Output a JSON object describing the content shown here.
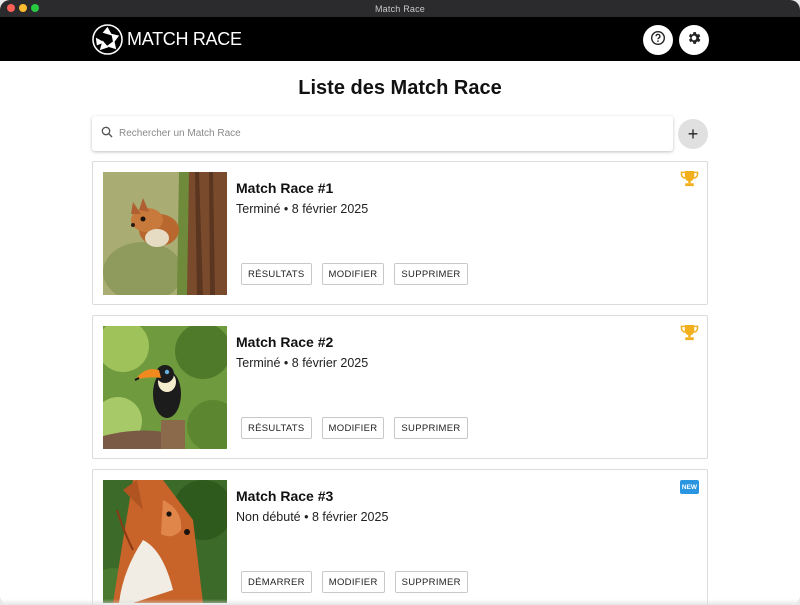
{
  "window": {
    "title": "Match Race"
  },
  "appbar": {
    "brand": "MATCH RACE",
    "logo_icon": "shutter-icon",
    "help_icon": "help-circle-icon",
    "settings_icon": "gear-icon"
  },
  "page": {
    "title": "Liste des Match Race"
  },
  "search": {
    "placeholder": "Rechercher un Match Race",
    "value": ""
  },
  "add_button": {
    "label": "+"
  },
  "races": [
    {
      "title": "Match Race #1",
      "subtitle": "Terminé • 8 février 2025",
      "image": "squirrel",
      "badge": "trophy-icon",
      "actions": [
        "RÉSULTATS",
        "MODIFIER",
        "SUPPRIMER"
      ]
    },
    {
      "title": "Match Race #2",
      "subtitle": "Terminé • 8 février 2025",
      "image": "toucan",
      "badge": "trophy-icon",
      "actions": [
        "RÉSULTATS",
        "MODIFIER",
        "SUPPRIMER"
      ]
    },
    {
      "title": "Match Race #3",
      "subtitle": "Non débuté • 8 février 2025",
      "image": "fox",
      "badge": "new-icon",
      "badge_text": "NEW",
      "actions": [
        "DÉMARRER",
        "MODIFIER",
        "SUPPRIMER"
      ]
    }
  ],
  "colors": {
    "appbar": "#000000",
    "trophy": "#f2b01e",
    "new_badge": "#2a95e0"
  }
}
